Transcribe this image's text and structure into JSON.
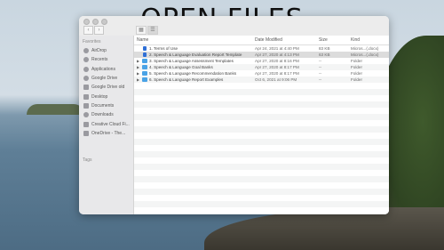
{
  "headline": "OPEN FILES",
  "colors": {
    "folder": "#4aa3e6",
    "doc": "#2f6fd6",
    "selection": "#dcdcdc"
  },
  "sidebar": {
    "favorites_label": "Favorites",
    "items": [
      {
        "label": "AirDrop",
        "icon": "airdrop-icon"
      },
      {
        "label": "Recents",
        "icon": "clock-icon"
      },
      {
        "label": "Applications",
        "icon": "applications-icon"
      },
      {
        "label": "Google Drive",
        "icon": "cloud-icon"
      },
      {
        "label": "Google Drive old",
        "icon": "folder-icon"
      },
      {
        "label": "Desktop",
        "icon": "desktop-icon"
      },
      {
        "label": "Documents",
        "icon": "document-icon"
      },
      {
        "label": "Downloads",
        "icon": "download-icon"
      },
      {
        "label": "Creative Cloud Fi...",
        "icon": "folder-icon"
      },
      {
        "label": "OneDrive - The...",
        "icon": "folder-icon"
      }
    ],
    "tags_label": "Tags"
  },
  "columns": {
    "name": "Name",
    "date": "Date Modified",
    "size": "Size",
    "kind": "Kind"
  },
  "files": [
    {
      "name": "1. Terms of Use",
      "date": "Apr 24, 2021 at 4:40 PM",
      "size": "83 KB",
      "kind": "Micros...(.docx)",
      "type": "doc",
      "selected": false
    },
    {
      "name": "2. Speech & Language Evaluation Report Template",
      "date": "Apr 27, 2020 at 4:13 PM",
      "size": "63 KB",
      "kind": "Micros...(.docx)",
      "type": "doc",
      "selected": true
    },
    {
      "name": "3. Speech & Language Assessment Templates",
      "date": "Apr 27, 2020 at 8:16 PM",
      "size": "--",
      "kind": "Folder",
      "type": "folder",
      "selected": false
    },
    {
      "name": "4. Speech & Language Goal Banks",
      "date": "Apr 27, 2020 at 8:17 PM",
      "size": "--",
      "kind": "Folder",
      "type": "folder",
      "selected": false
    },
    {
      "name": "5. Speech & Language Recommendation Banks",
      "date": "Apr 27, 2020 at 8:17 PM",
      "size": "--",
      "kind": "Folder",
      "type": "folder",
      "selected": false
    },
    {
      "name": "6. Speech & Language Report Examples",
      "date": "Oct 6, 2021 at 9:06 PM",
      "size": "--",
      "kind": "Folder",
      "type": "folder",
      "selected": false
    }
  ]
}
